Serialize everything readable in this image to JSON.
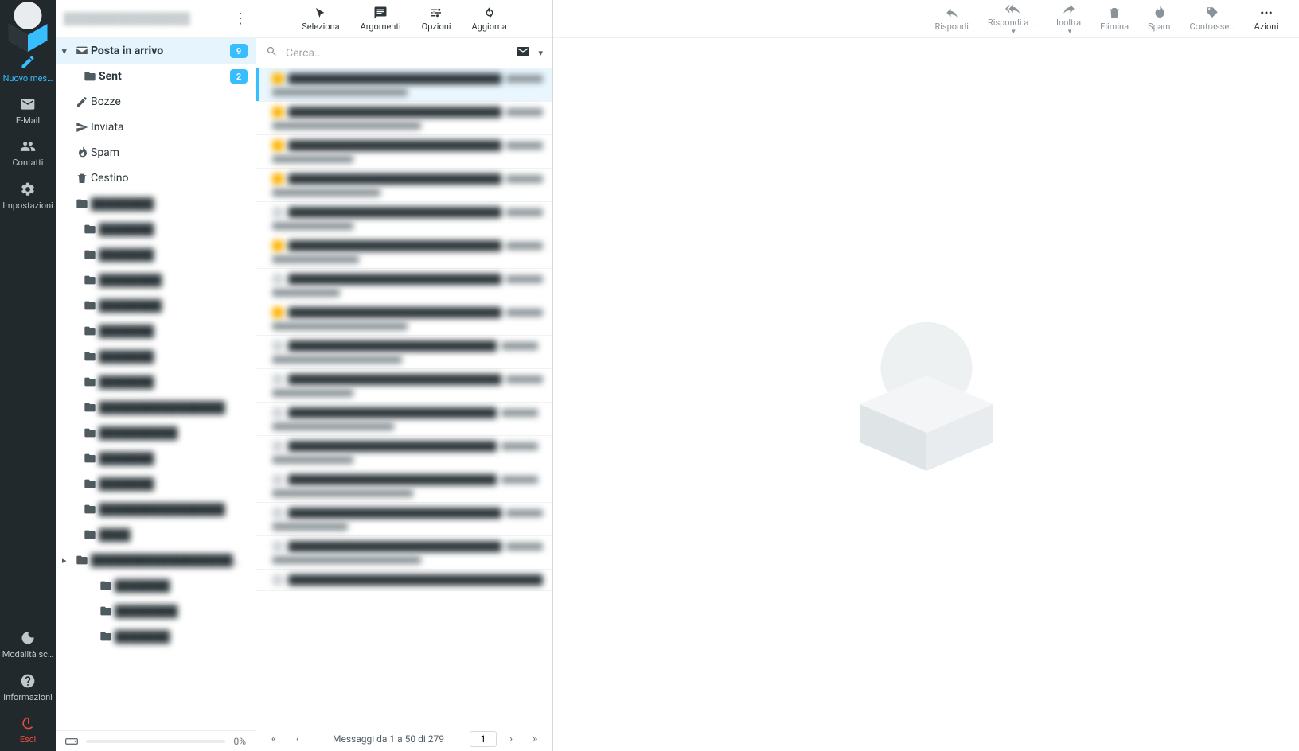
{
  "rail": {
    "compose": "Nuovo mes…",
    "mail": "E-Mail",
    "contacts": "Contatti",
    "settings": "Impostazioni",
    "dark": "Modalità sc…",
    "info": "Informazioni",
    "logout": "Esci"
  },
  "account": {
    "name": "████████████████"
  },
  "folders": {
    "inbox": "Posta in arrivo",
    "inbox_badge": "9",
    "sent": "Sent",
    "sent_badge": "2",
    "drafts": "Bozze",
    "sent2": "Inviata",
    "spam": "Spam",
    "trash": "Cestino"
  },
  "quota": {
    "percent": "0%"
  },
  "list_toolbar": {
    "select": "Seleziona",
    "threads": "Argomenti",
    "options": "Opzioni",
    "refresh": "Aggiorna"
  },
  "search": {
    "placeholder": "Cerca..."
  },
  "pager": {
    "text": "Messaggi da 1 a 50 di 279",
    "page": "1"
  },
  "msg_toolbar": {
    "reply": "Rispondi",
    "replyall": "Rispondi a t…",
    "forward": "Inoltra",
    "delete": "Elimina",
    "junk": "Spam",
    "mark": "Contrasse…",
    "actions": "Azioni"
  }
}
